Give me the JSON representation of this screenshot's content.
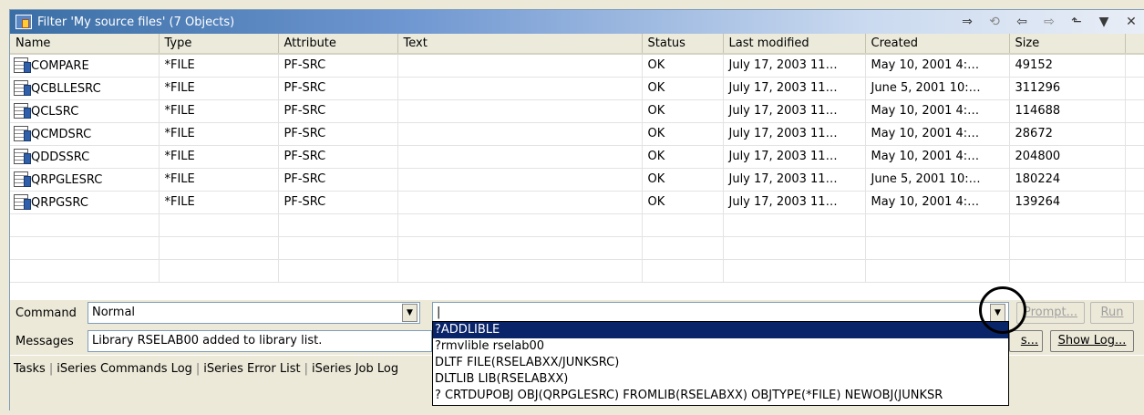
{
  "window": {
    "title": "Filter 'My source files' (7 Objects)",
    "toolbar_icons": [
      "link-with-editor-icon",
      "refresh-icon",
      "back-arrow-icon",
      "forward-arrow-icon",
      "up-folder-icon",
      "menu-dropdown-icon",
      "close-icon"
    ],
    "toolbar_glyphs": [
      "⇒",
      "⟲",
      "⇦",
      "⇨",
      "⬑",
      "▼",
      "✕"
    ]
  },
  "table": {
    "columns": [
      "Name",
      "Type",
      "Attribute",
      "Text",
      "Status",
      "Last modified",
      "Created",
      "Size"
    ],
    "rows": [
      {
        "name": "COMPARE",
        "type": "*FILE",
        "attribute": "PF-SRC",
        "text": "",
        "status": "OK",
        "modified": "July 17, 2003 11…",
        "created": "May 10, 2001 4:…",
        "size": "49152"
      },
      {
        "name": "QCBLLESRC",
        "type": "*FILE",
        "attribute": "PF-SRC",
        "text": "",
        "status": "OK",
        "modified": "July 17, 2003 11…",
        "created": "June 5, 2001 10:…",
        "size": "311296"
      },
      {
        "name": "QCLSRC",
        "type": "*FILE",
        "attribute": "PF-SRC",
        "text": "",
        "status": "OK",
        "modified": "July 17, 2003 11…",
        "created": "May 10, 2001 4:…",
        "size": "114688"
      },
      {
        "name": "QCMDSRC",
        "type": "*FILE",
        "attribute": "PF-SRC",
        "text": "",
        "status": "OK",
        "modified": "July 17, 2003 11…",
        "created": "May 10, 2001 4:…",
        "size": "28672"
      },
      {
        "name": "QDDSSRC",
        "type": "*FILE",
        "attribute": "PF-SRC",
        "text": "",
        "status": "OK",
        "modified": "July 17, 2003 11…",
        "created": "May 10, 2001 4:…",
        "size": "204800"
      },
      {
        "name": "QRPGLESRC",
        "type": "*FILE",
        "attribute": "PF-SRC",
        "text": "",
        "status": "OK",
        "modified": "July 17, 2003 11…",
        "created": "June 5, 2001 10:…",
        "size": "180224"
      },
      {
        "name": "QRPGSRC",
        "type": "*FILE",
        "attribute": "PF-SRC",
        "text": "",
        "status": "OK",
        "modified": "July 17, 2003 11…",
        "created": "May 10, 2001 4:…",
        "size": "139264"
      }
    ]
  },
  "command": {
    "label": "Command",
    "mode_value": "Normal",
    "input_value": "|",
    "prompt_label": "Prompt...",
    "run_label": "Run"
  },
  "messages": {
    "label": "Messages",
    "value": "Library RSELAB00 added to library list.",
    "details_label": "s...",
    "show_log_label": "Show Log..."
  },
  "history": [
    "?ADDLIBLE",
    "?rmvlible rselab00",
    "DLTF FILE(RSELABXX/JUNKSRC)",
    "DLTLIB LIB(RSELABXX)",
    "? CRTDUPOBJ OBJ(QRPGLESRC) FROMLIB(RSELABXX) OBJTYPE(*FILE) NEWOBJ(JUNKSR"
  ],
  "tabs": [
    "Tasks",
    "iSeries Commands Log",
    "iSeries Error List",
    "iSeries Job Log"
  ]
}
